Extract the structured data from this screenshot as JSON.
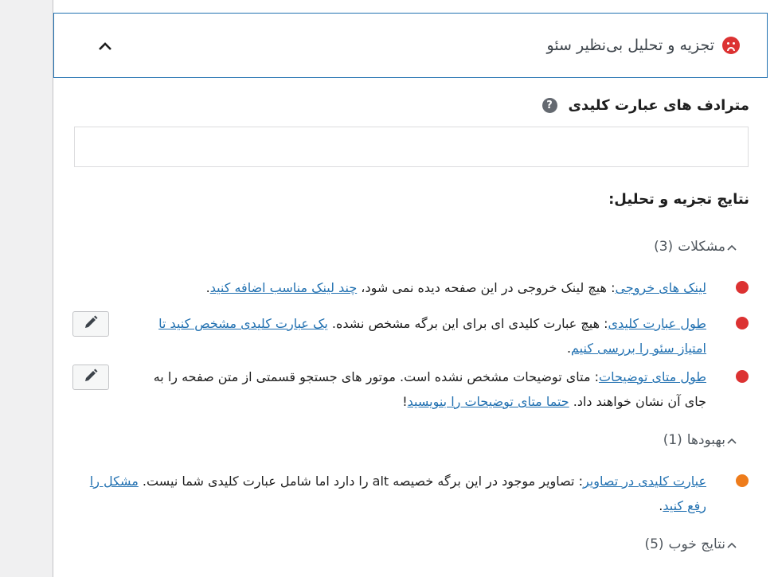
{
  "header": {
    "title": "تجزیه و تحلیل بی‌نظیر سئو",
    "collapse_icon": "chevron-up-icon",
    "status_icon": "sad-face-icon",
    "status_color": "#dc3232"
  },
  "synonyms": {
    "label": "مترادف های عبارت کلیدی",
    "help_icon": "?",
    "input_value": "",
    "input_placeholder": ""
  },
  "analysis": {
    "title": "نتایج تجزیه و تحلیل:",
    "groups": {
      "problems": {
        "label": "مشکلات",
        "count": "(3)"
      },
      "improvements": {
        "label": "بهبودها",
        "count": "(1)"
      },
      "good": {
        "label": "نتایج خوب",
        "count": "(5)"
      }
    },
    "results": [
      {
        "status": "red",
        "link_title": "لینک های خروجی",
        "text": ": هیچ لینک خروجی در این صفحه دیده نمی شود، ",
        "action_link": "چند لینک مناسب اضافه کنید",
        "end": "."
      },
      {
        "status": "red",
        "link_title": "طول عبارت کلیدی",
        "text": ": هیچ عبارت کلیدی ای برای این برگه مشخص نشده. ",
        "action_link": "یک عبارت کلیدی مشخص کنید تا امتیاز سئو را بررسی کنیم",
        "end": ".",
        "has_edit": true
      },
      {
        "status": "red",
        "link_title": "طول متای توضیحات",
        "text": ": متای توضیحات مشخص نشده است. موتور های جستجو قسمتی از متن صفحه را به جای آن نشان خواهند داد. ",
        "action_link": "حتما متای توضیحات را بنویسید",
        "end": "!",
        "has_edit": true
      },
      {
        "status": "orange",
        "link_title": "عبارت کلیدی در تصاویر",
        "text": ": تصاویر موجود در این برگه خصیصه alt را دارد اما شامل عبارت کلیدی شما نیست. ",
        "action_link": "مشکل را رفع کنید",
        "end": "."
      }
    ]
  },
  "colors": {
    "accent": "#2271b1",
    "problem": "#dc3232",
    "improvement": "#ee7c1b"
  }
}
